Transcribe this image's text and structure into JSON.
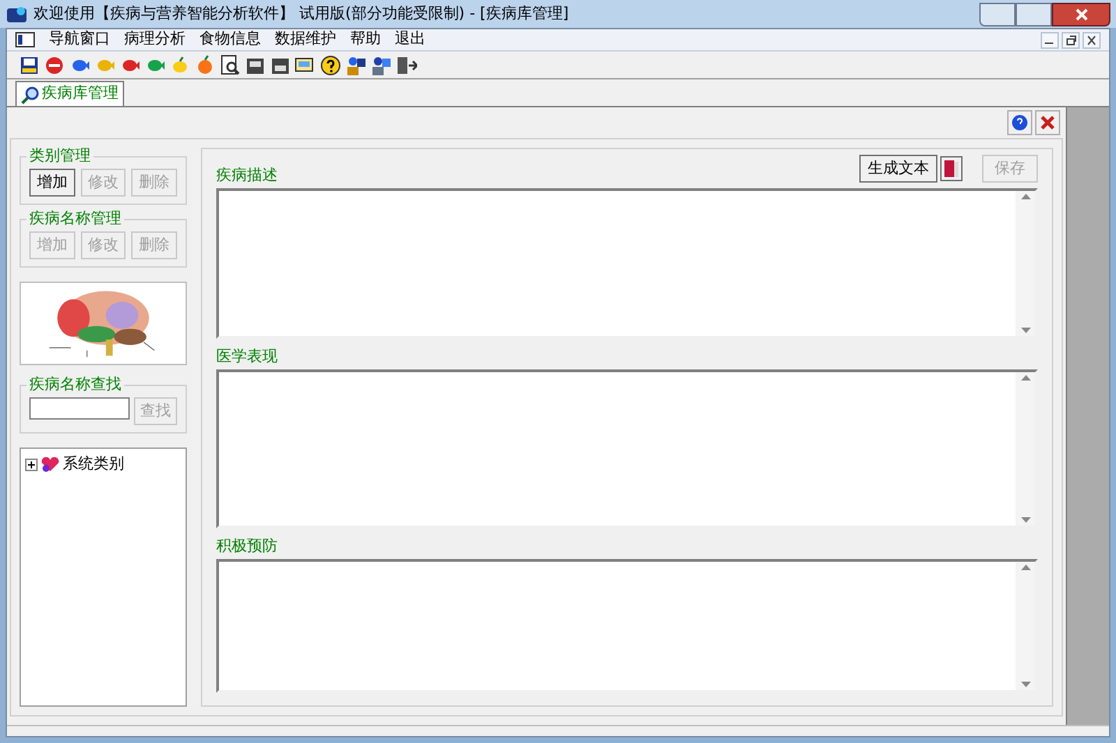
{
  "window": {
    "title": "欢迎使用【疾病与营养智能分析软件】 试用版(部分功能受限制) - [疾病库管理]"
  },
  "menu": [
    {
      "label": "导航窗口"
    },
    {
      "label": "病理分析"
    },
    {
      "label": "食物信息"
    },
    {
      "label": "数据维护"
    },
    {
      "label": "帮助"
    },
    {
      "label": "退出"
    }
  ],
  "tab": {
    "label": "疾病库管理",
    "selected": true
  },
  "category_group": {
    "title": "类别管理",
    "buttons": [
      {
        "label": "增加",
        "disabled": false
      },
      {
        "label": "修改",
        "disabled": true
      },
      {
        "label": "删除",
        "disabled": true
      }
    ]
  },
  "disease_group": {
    "title": "疾病名称管理",
    "buttons": [
      {
        "label": "增加",
        "disabled": true
      },
      {
        "label": "修改",
        "disabled": true
      },
      {
        "label": "删除",
        "disabled": true
      }
    ]
  },
  "search": {
    "title": "疾病名称查找",
    "button": {
      "label": "查找",
      "disabled": true
    }
  },
  "tree": [
    {
      "label": "系统类别",
      "expanded": false
    }
  ],
  "sections": [
    {
      "label": "疾病描述"
    },
    {
      "label": "医学表现"
    },
    {
      "label": "积极预防"
    }
  ],
  "actions": [
    {
      "label": "生成文本",
      "disabled": false
    },
    {
      "label": "保存",
      "disabled": true
    }
  ]
}
